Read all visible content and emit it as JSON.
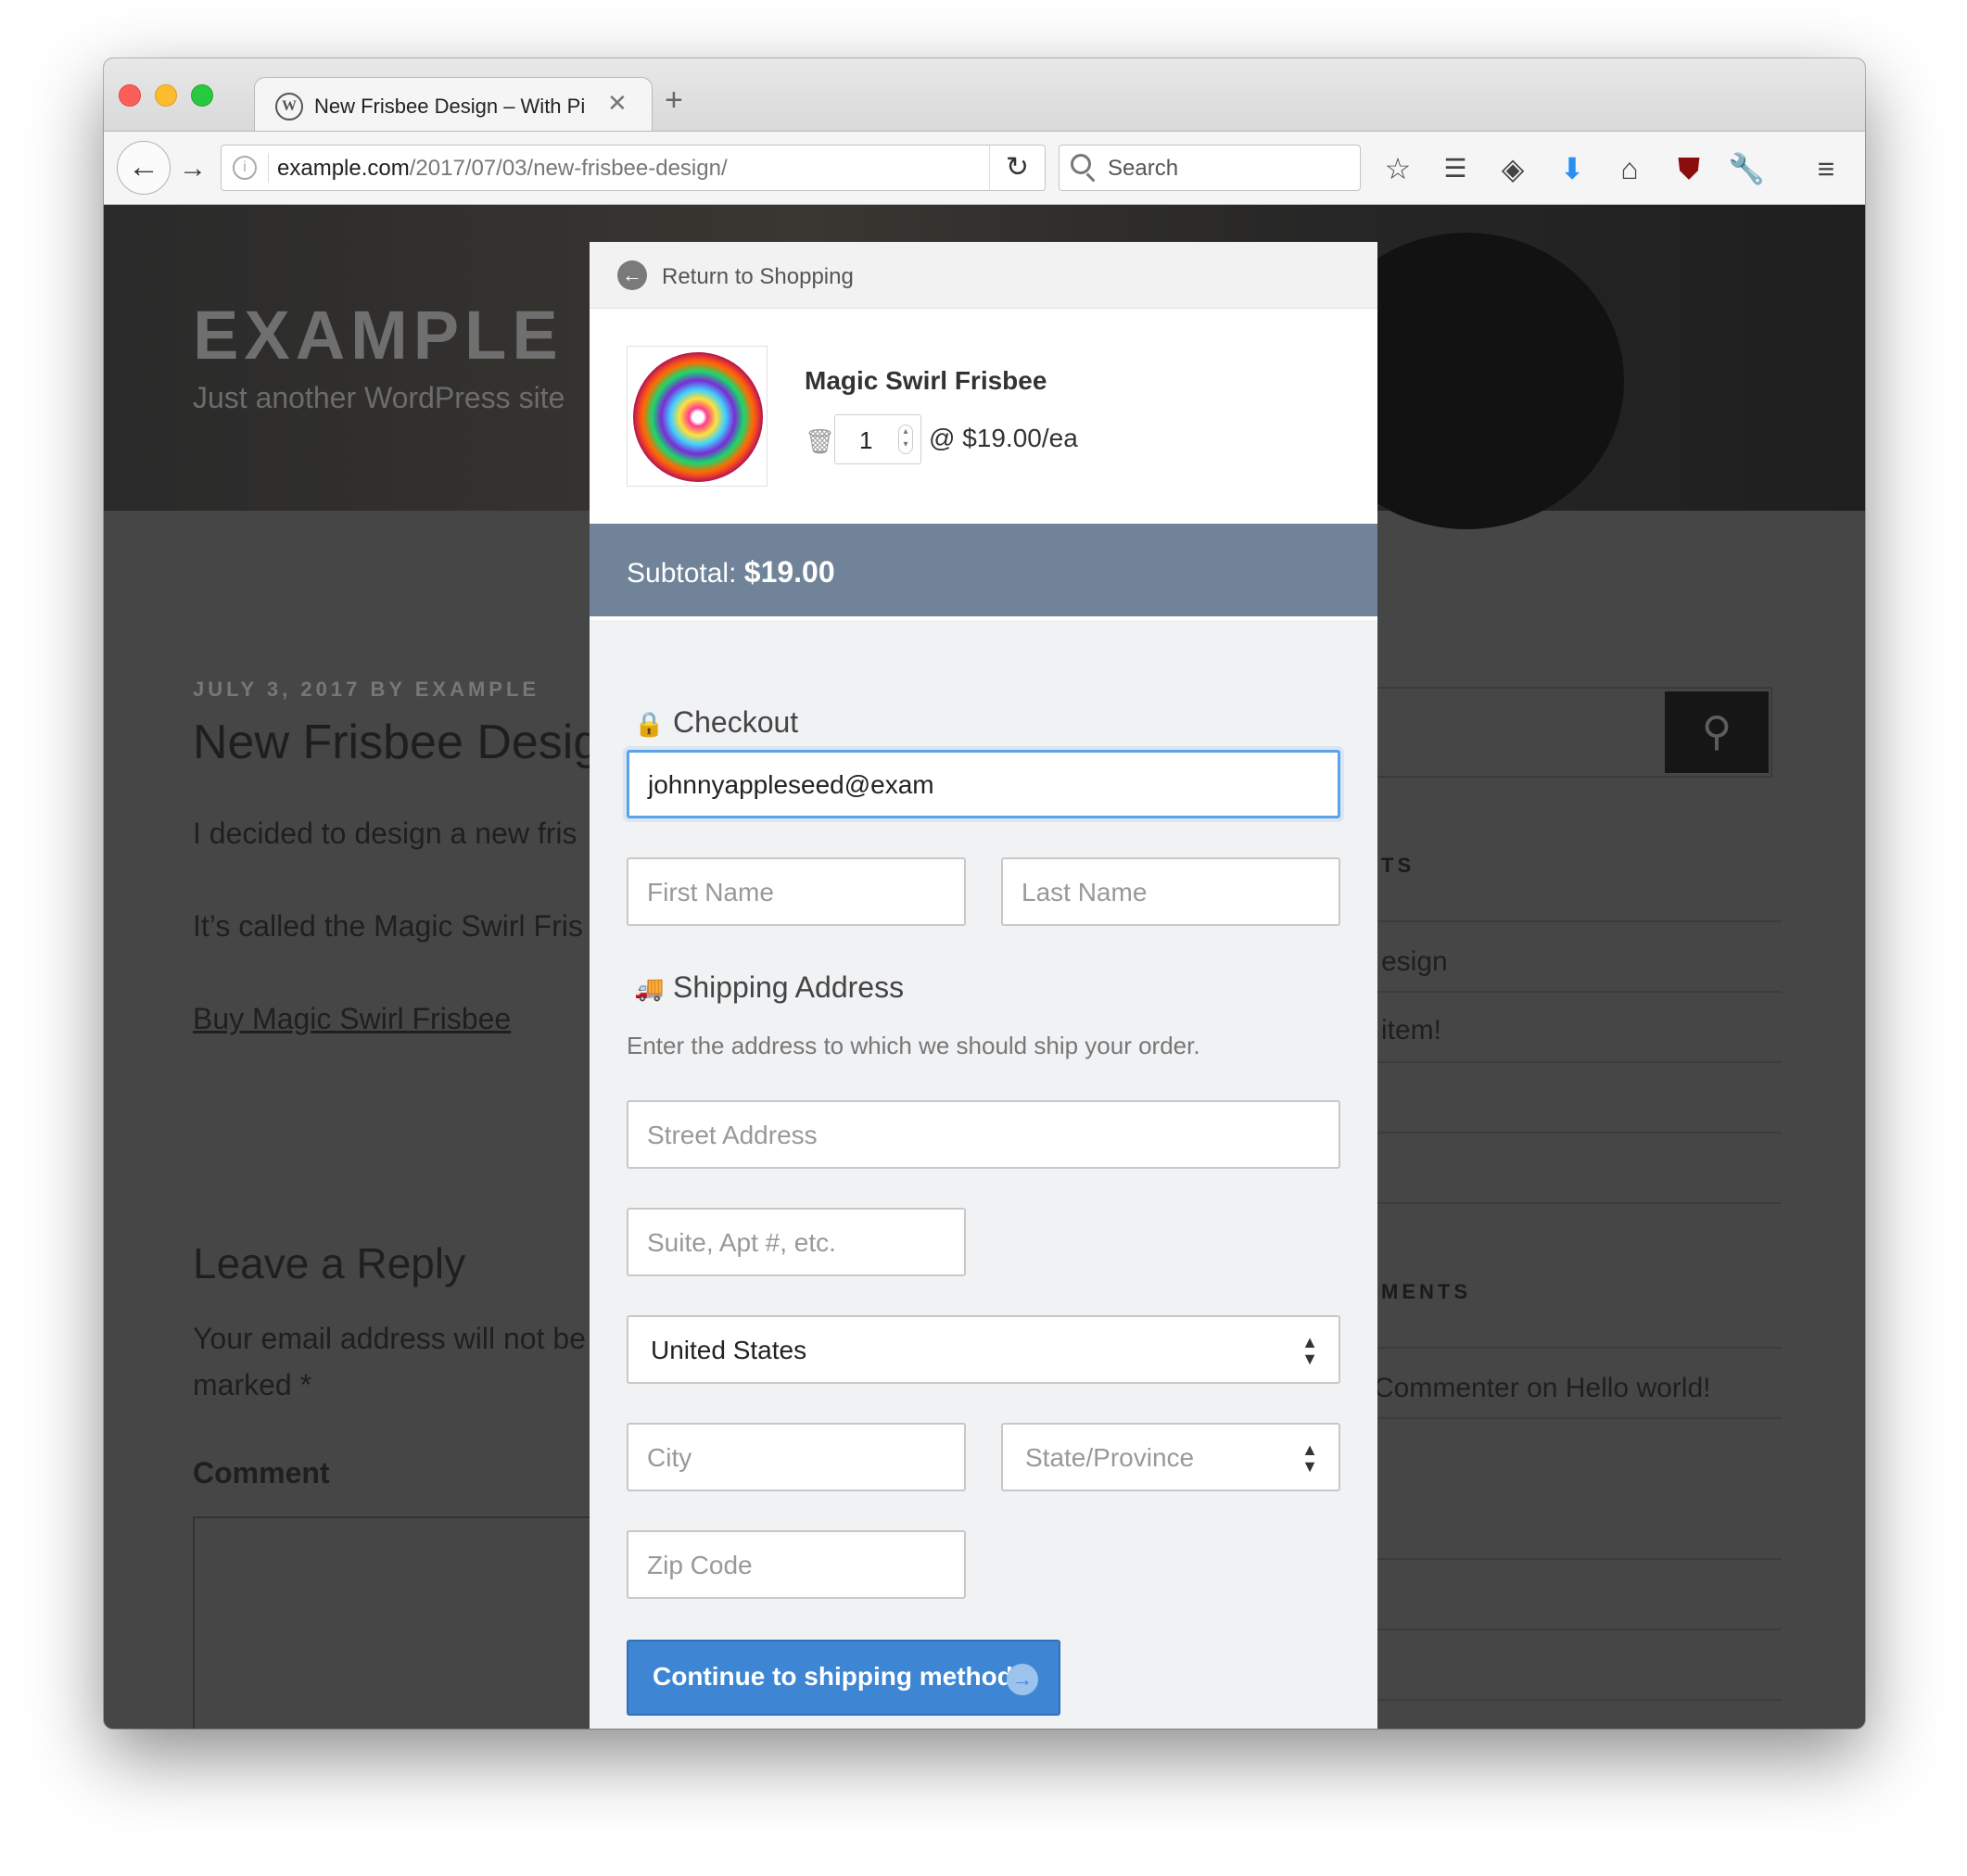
{
  "browser": {
    "tab_title": "New Frisbee Design – With Pi",
    "url_host": "example.com",
    "url_path": "/2017/07/03/new-frisbee-design/",
    "search_placeholder": "Search"
  },
  "blog": {
    "site_title": "EXAMPLE",
    "site_description": "Just another WordPress site",
    "post_meta": "JULY 3, 2017 BY EXAMPLE",
    "post_title": "New Frisbee Desig",
    "para1": "I decided to design a new fris",
    "para2": "It’s called the Magic Swirl Fris",
    "buy_link": "Buy Magic Swirl Frisbee",
    "reply_heading": "Leave a Reply",
    "reply_note_1": "Your email address will not be",
    "reply_note_2": "marked *",
    "comment_label": "Comment",
    "sidebar_heading_1": "TS",
    "sidebar_items_1": [
      "esign",
      "item!"
    ],
    "sidebar_heading_2": "MENTS",
    "sidebar_items_2": [
      "Commenter on Hello world!"
    ]
  },
  "checkout": {
    "return_label": "Return to Shopping",
    "product_name": "Magic Swirl Frisbee",
    "quantity": "1",
    "unit_price": "@ $19.00/ea",
    "subtotal_label": "Subtotal:",
    "subtotal_value": "$19.00",
    "checkout_heading": "Checkout",
    "email_value": "johnnyappleseed@exam",
    "first_name_placeholder": "First Name",
    "last_name_placeholder": "Last Name",
    "shipping_heading": "Shipping Address",
    "shipping_description": "Enter the address to which we should ship your order.",
    "street_placeholder": "Street Address",
    "suite_placeholder": "Suite, Apt #, etc.",
    "country_selected": "United States",
    "city_placeholder": "City",
    "state_placeholder": "State/Province",
    "zip_placeholder": "Zip Code",
    "continue_label": "Continue to shipping method"
  },
  "colors": {
    "subtotal_bar": "#718399",
    "cta": "#3e86d4",
    "focus_ring": "#5aa3e8"
  }
}
